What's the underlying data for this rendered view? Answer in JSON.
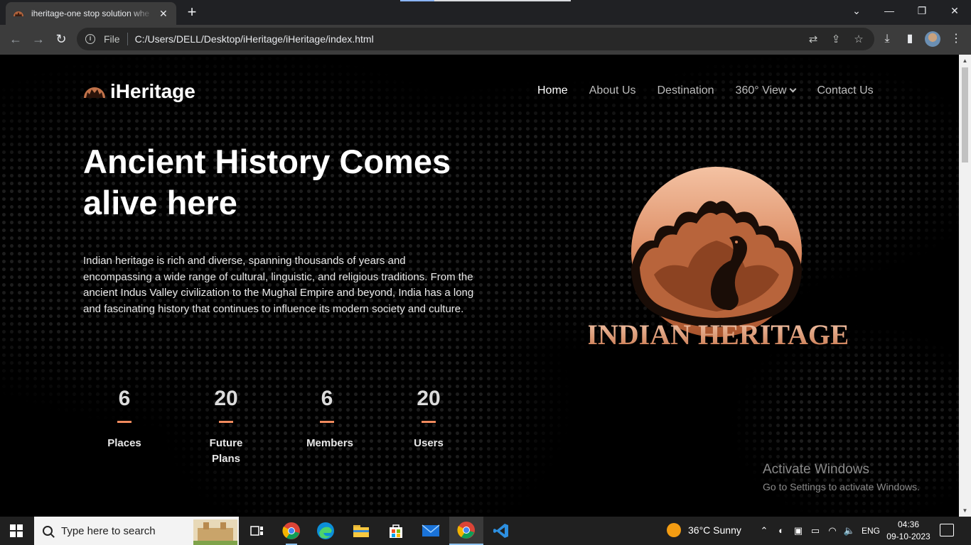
{
  "browser": {
    "tab_title": "iheritage-one stop solution whe",
    "url_scheme_label": "File",
    "url": "C:/Users/DELL/Desktop/iHeritage/iHeritage/index.html",
    "new_tab_label": "+",
    "tab_close_label": "✕",
    "window_controls": {
      "collapse": "⌄",
      "minimize": "—",
      "restore": "❐",
      "close": "✕"
    },
    "icons": [
      "back-icon",
      "forward-icon",
      "reload-icon",
      "info-icon",
      "translate-icon",
      "share-icon",
      "star-icon",
      "download-icon",
      "side-panel-icon",
      "profile-avatar",
      "kebab-menu-icon"
    ]
  },
  "site": {
    "brand": "iHeritage",
    "nav": {
      "home": "Home",
      "about": "About Us",
      "destination": "Destination",
      "view360": "360° View",
      "contact": "Contact Us"
    },
    "hero": {
      "title": "Ancient History Comes alive here",
      "text": "Indian heritage is rich and diverse, spanning thousands of years and encompassing a wide range of cultural, linguistic, and religious traditions. From the ancient Indus Valley civilization to the Mughal Empire and beyond, India has a long and fascinating history that continues to influence its modern society and culture."
    },
    "stats": [
      {
        "value": "6",
        "label": "Places"
      },
      {
        "value": "20",
        "label": "Future Plans"
      },
      {
        "value": "6",
        "label": "Members"
      },
      {
        "value": "20",
        "label": "Users"
      }
    ],
    "logo_text": "INDIAN HERITAGE",
    "accent_color": "#f08a5d"
  },
  "watermark": {
    "title": "Activate Windows",
    "subtitle": "Go to Settings to activate Windows."
  },
  "taskbar": {
    "search_placeholder": "Type here to search",
    "weather": "36°C  Sunny",
    "language": "ENG",
    "time": "04:36",
    "date": "09-10-2023",
    "apps": [
      "task-view",
      "chrome",
      "edge",
      "file-explorer",
      "microsoft-store",
      "mail",
      "chrome-active",
      "vscode"
    ]
  }
}
